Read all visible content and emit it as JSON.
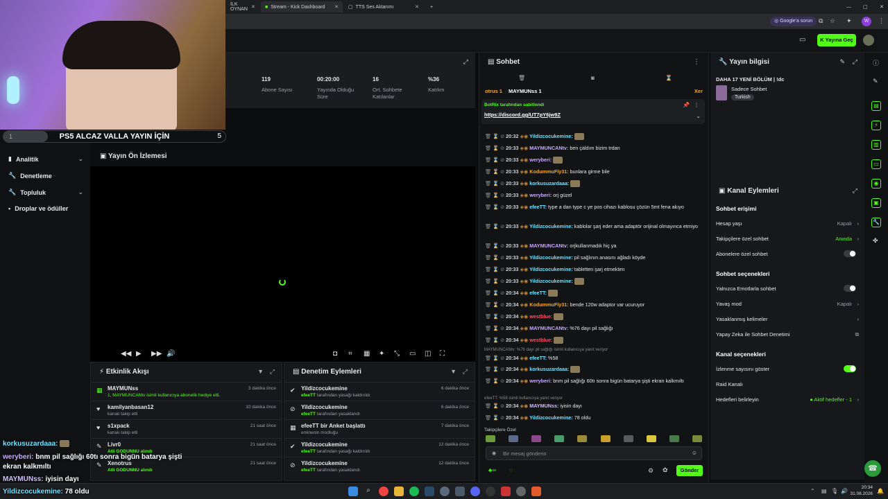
{
  "browser": {
    "tabs": [
      {
        "label": "İLK OYNAN",
        "active": false
      },
      {
        "label": "Stream - Kick Dashboard",
        "active": true
      },
      {
        "label": "TTS Ses Aktarımı",
        "active": false
      }
    ],
    "google_prompt": "Google'a sorun",
    "live_button": "Yayına Geç"
  },
  "goal": {
    "left": "1",
    "title": "PS5 ALCAZ VALLA YAYIN İÇİN",
    "right": "5"
  },
  "nav": [
    {
      "label": "Analitik",
      "chevron": true
    },
    {
      "label": "Denetleme",
      "chevron": false
    },
    {
      "label": "Topluluk",
      "chevron": true
    },
    {
      "label": "Droplar ve ödüller",
      "chevron": false
    }
  ],
  "stats": [
    {
      "value": "119",
      "label": "Abone Sayısı"
    },
    {
      "value": "00:20:00",
      "label": "Yayında Olduğu Süre"
    },
    {
      "value": "16",
      "label": "Ort. Sohbete Katılanlar"
    },
    {
      "value": "%36",
      "label": "Katılım"
    }
  ],
  "preview": {
    "title": "Yayın Ön İzlemesi"
  },
  "activity": {
    "title": "Etkinlik Akışı",
    "items": [
      {
        "name": "MAYMUNss",
        "sub": "1, MAYMUNCANtv isimli kullanıcıya abonelik hediye etti.",
        "time": "3 dakika önce"
      },
      {
        "name": "kamilyanbasan12",
        "sub": "kanalı takip etti",
        "time": "10 dakika önce"
      },
      {
        "name": "s1xpack",
        "sub": "kanalı takip etti",
        "time": "21 saat önce"
      },
      {
        "name": "Livr0",
        "sub": "Atli GODUNNU alındı",
        "time": "21 saat önce"
      },
      {
        "name": "Xenotrus",
        "sub": "Atli GODUNNU alındı",
        "time": "21 saat önce"
      }
    ]
  },
  "moderation": {
    "title": "Denetim Eylemleri",
    "items": [
      {
        "name": "Yildizcocukemine",
        "by": "efeeTT",
        "sub": "tarafından yasağı kaldırıldı",
        "time": "6 dakika önce"
      },
      {
        "name": "Yildizcocukemine",
        "by": "efeeTT",
        "sub": "tarafından yasaklandı",
        "time": "6 dakika önce"
      },
      {
        "name": "efeeTT bir Anket başlattı",
        "by": "",
        "sub": "eminenin modluğu",
        "time": "7 dakika önce"
      },
      {
        "name": "Yildizcocukemine",
        "by": "efeeTT",
        "sub": "tarafından yasağı kaldırıldı",
        "time": "12 dakika önce"
      },
      {
        "name": "Yildizcocukemine",
        "by": "efeeTT",
        "sub": "tarafından yasaklandı",
        "time": "12 dakika önce"
      }
    ]
  },
  "overlay_chat": [
    {
      "user": "korkusuzardaaa:",
      "text": "",
      "color": "#6fe3ff"
    },
    {
      "user": "weryberi:",
      "text": "bnm pil sağlığı 60tı sonra bigün batarya şişti",
      "color": "#c8a8ff"
    },
    {
      "user": "",
      "text": "ekran kalkmıltı",
      "color": "#fff"
    },
    {
      "user": "MAYMUNss:",
      "text": "iyisin dayı",
      "color": "#d4c0ff"
    },
    {
      "user": "Yildizcocukemine:",
      "text": "78 oldu",
      "color": "#6fe3ff"
    }
  ],
  "chat": {
    "title": "Sohbet",
    "top_users": [
      "otrus 1",
      "MAYMUNss 1",
      "Xer"
    ],
    "pinned_by": "BotRix tarafından sabitlendi",
    "pinned_link": "https://discord.gg/UT7pY6jw9Z",
    "messages": [
      {
        "time": "20:32",
        "user": "Yildizcocukemine:",
        "color": "#6fe3ff",
        "text": ""
      },
      {
        "time": "20:33",
        "user": "MAYMUNCANtv:",
        "color": "#c8a8ff",
        "text": "ben çaldım bizim trdan"
      },
      {
        "time": "20:33",
        "user": "weryberi:",
        "color": "#c8a8ff",
        "text": ""
      },
      {
        "time": "20:33",
        "user": "KodummuFly31:",
        "color": "#f5a623",
        "text": "bunlara girme bile"
      },
      {
        "time": "20:33",
        "user": "korkusuzardaaa:",
        "color": "#6fe3ff",
        "text": ""
      },
      {
        "time": "20:33",
        "user": "weryberi:",
        "color": "#c8a8ff",
        "text": "orj güzel"
      },
      {
        "time": "20:33",
        "user": "efeeTT:",
        "color": "#6fe3ff",
        "text": "type a dan type c ye pos cihazı kablosu çözün 5mt fena akıyo"
      },
      {
        "time": "20:33",
        "user": "Yildizcocukemine:",
        "color": "#6fe3ff",
        "text": "kablolar şarj eder ama adaptör orijinal olmayınca etmiyo"
      },
      {
        "time": "20:33",
        "user": "MAYMUNCANtv:",
        "color": "#c8a8ff",
        "text": "orjkullanmadık hiç ya"
      },
      {
        "time": "20:33",
        "user": "Yildizcocukemine:",
        "color": "#6fe3ff",
        "text": "pil sağlının anasını ağladı köyde"
      },
      {
        "time": "20:33",
        "user": "Yildizcocukemine:",
        "color": "#6fe3ff",
        "text": "tabletten şarj etmekten"
      },
      {
        "time": "20:33",
        "user": "Yildizcocukemine:",
        "color": "#6fe3ff",
        "text": ""
      },
      {
        "time": "20:34",
        "user": "efeeTT:",
        "color": "#6fe3ff",
        "text": ""
      },
      {
        "time": "20:34",
        "user": "KodummuFly31:",
        "color": "#f5a623",
        "text": "bende 120w adaptor var ucuruyor"
      },
      {
        "time": "20:34",
        "user": "westblue:",
        "color": "#ff4d6a",
        "text": ""
      },
      {
        "time": "20:34",
        "user": "MAYMUNCANtv:",
        "color": "#c8a8ff",
        "text": "%76 dayı pil sağlığı"
      },
      {
        "time": "20:34",
        "user": "westblue:",
        "color": "#ff4d6a",
        "text": ""
      },
      {
        "time": "20:34",
        "user": "efeeTT:",
        "color": "#6fe3ff",
        "text": "%58"
      },
      {
        "time": "20:34",
        "user": "korkusuzardaaa:",
        "color": "#6fe3ff",
        "text": ""
      },
      {
        "time": "20:34",
        "user": "weryberi:",
        "color": "#c8a8ff",
        "text": "bnm pil sağlığı 60tı sonra bigün batarya şişti ekran kalkmıltı"
      },
      {
        "time": "20:34",
        "user": "MAYMUNss:",
        "color": "#d4c0ff",
        "text": "iyisin dayı"
      },
      {
        "time": "20:34",
        "user": "Yildizcocukemine:",
        "color": "#6fe3ff",
        "text": "78 oldu"
      }
    ],
    "reply_hint_1": "MAYMUNCANtv: %76 dayı pil sağlığı isimli kullanıcıya yanıt veriyor",
    "reply_hint_2": "efeeTT: %58 isimli kullanıcıya yanıt veriyor",
    "followers_label": "Takipçilere Özel",
    "input_placeholder": "Bir mesaj gönderin",
    "send_label": "Gönder"
  },
  "stream_info": {
    "title": "Yayın bilgisi",
    "stream_title": "DAHA 17 YENİ BÖLÜM | !dc",
    "category": "Sadece Sohbet",
    "tag": "Turkish"
  },
  "channel": {
    "title": "Kanal Eylemleri",
    "sections": [
      {
        "heading": "Sohbet erişimi",
        "rows": [
          {
            "label": "Hesap yaşı",
            "value": "Kapalı",
            "kind": "chevron"
          },
          {
            "label": "Takipçilere özel sohbet",
            "value": "Anında",
            "kind": "chevron-green"
          },
          {
            "label": "Abonelere özel sohbet",
            "value": "",
            "kind": "toggle-off"
          }
        ]
      },
      {
        "heading": "Sohbet seçenekleri",
        "rows": [
          {
            "label": "Yalnızca Emotlarla sohbet",
            "value": "",
            "kind": "toggle-off"
          },
          {
            "label": "Yavaş mod",
            "value": "Kapalı",
            "kind": "chevron"
          },
          {
            "label": "Yasaklanmış kelimeler",
            "value": "",
            "kind": "chevron"
          },
          {
            "label": "Yapay Zeka ile Sohbet Denetimi",
            "value": "",
            "kind": "external"
          }
        ]
      },
      {
        "heading": "Kanal seçenekleri",
        "rows": [
          {
            "label": "İzlenme sayısını göster",
            "value": "",
            "kind": "toggle-on"
          },
          {
            "label": "Raid Kanalı",
            "value": "",
            "kind": "none"
          },
          {
            "label": "Hedefleri belirleyin",
            "value": "● Aktif hedefler - 1",
            "kind": "chevron-green"
          }
        ]
      }
    ]
  },
  "taskbar": {
    "time": "20:34",
    "date": "31.08.2026"
  }
}
